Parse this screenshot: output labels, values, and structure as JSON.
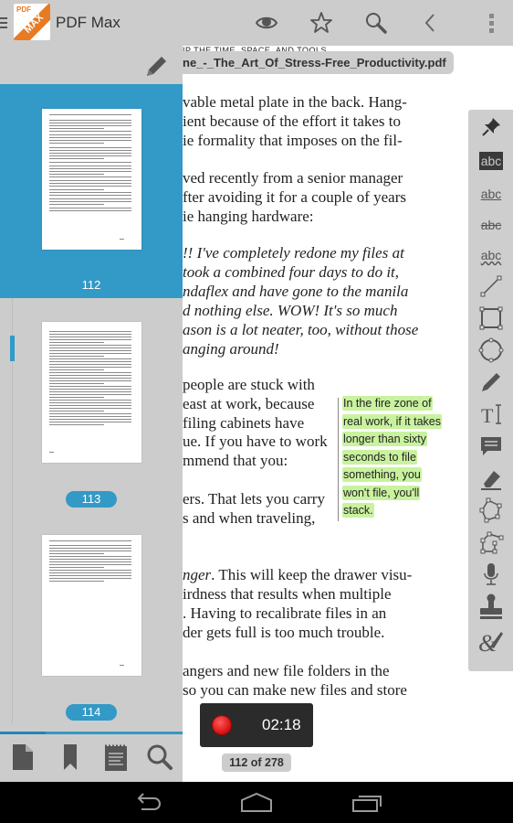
{
  "app": {
    "title": "PDF Max",
    "logo_top": "PDF",
    "logo_band": "MAX"
  },
  "actionbar": {
    "icons": [
      "menu-icon",
      "eye-icon",
      "star-icon",
      "search-icon",
      "chevron-left-icon",
      "overflow-menu-icon"
    ]
  },
  "document": {
    "running_head": "IP THE TIME, SPACE, AND TOOLS",
    "filename": "ne_-_The_Art_Of_Stress-Free_Productivity.pdf",
    "lines": [
      {
        "text": "vable metal plate in the back. Hang-",
        "style": "normal"
      },
      {
        "text": "ient because of the effort it takes to",
        "style": "normal"
      },
      {
        "text": "ie formality that imposes on the fil-",
        "style": "normal"
      },
      {
        "text": "",
        "style": "normal"
      },
      {
        "text": "ved recently from a senior manager",
        "style": "normal"
      },
      {
        "text": "fter avoiding it for a couple of years",
        "style": "normal"
      },
      {
        "text": "ie hanging hardware:",
        "style": "normal"
      },
      {
        "text": "",
        "style": "normal"
      },
      {
        "text": "!! I've completely redone my files at",
        "style": "italic"
      },
      {
        "text": "took a combined four days to do it,",
        "style": "italic"
      },
      {
        "text": "ndaflex and have gone to the manila",
        "style": "italic"
      },
      {
        "text": "d nothing else. WOW! It's so much",
        "style": "italic"
      },
      {
        "text": "ason is a lot neater, too, without those",
        "style": "italic"
      },
      {
        "text": "anging around!",
        "style": "italic"
      }
    ],
    "lines2": [
      "people are stuck with",
      "east at work, because",
      " filing cabinets have",
      "ue. If you have to work",
      "mmend that you:",
      "",
      "ers. That lets you carry",
      "s and when traveling,"
    ],
    "lines3": [
      {
        "text": "nger. This will keep the drawer visu-",
        "italic_prefix": "nger"
      },
      {
        "text": "irdness that results when multiple",
        "italic_prefix": ""
      },
      {
        "text": ". Having to recalibrate files in an",
        "italic_prefix": ""
      },
      {
        "text": "der gets full is too much trouble.",
        "italic_prefix": ""
      },
      {
        "text": "",
        "italic_prefix": ""
      },
      {
        "text": "angers and new file folders in the",
        "italic_prefix": ""
      },
      {
        "text": "so you can make new files and store",
        "italic_prefix": ""
      }
    ],
    "sidenote": [
      "In the fire zone of",
      "real work, if it takes",
      "longer than sixty",
      "seconds to file",
      "something, you",
      "won't file, you'll",
      "stack."
    ],
    "highlight_color": "#c9f29e"
  },
  "annotation_tools": [
    {
      "name": "pin-note-tool",
      "label": ""
    },
    {
      "name": "highlight-tool",
      "label": "abc"
    },
    {
      "name": "underline-tool",
      "label": "abc"
    },
    {
      "name": "strikeout-tool",
      "label": "abc"
    },
    {
      "name": "squiggly-tool",
      "label": "abc"
    },
    {
      "name": "line-tool",
      "label": ""
    },
    {
      "name": "rectangle-tool",
      "label": ""
    },
    {
      "name": "ellipse-tool",
      "label": ""
    },
    {
      "name": "pencil-tool",
      "label": ""
    },
    {
      "name": "text-box-tool",
      "label": "T"
    },
    {
      "name": "comment-tool",
      "label": ""
    },
    {
      "name": "eraser-tool",
      "label": ""
    },
    {
      "name": "polygon-tool",
      "label": ""
    },
    {
      "name": "polyline-tool",
      "label": ""
    },
    {
      "name": "audio-tool",
      "label": ""
    },
    {
      "name": "stamp-tool",
      "label": ""
    },
    {
      "name": "signature-tool",
      "label": ""
    }
  ],
  "recording": {
    "time": "02:18",
    "status": "recording"
  },
  "page_indicator": "112 of 278",
  "sidebar": {
    "thumbnails": [
      {
        "page": "112",
        "selected": true
      },
      {
        "page": "113",
        "selected": false
      },
      {
        "page": "114",
        "selected": false
      }
    ],
    "progress_fraction": 0.25,
    "tabs": [
      "pages-tab",
      "bookmarks-tab",
      "notes-tab",
      "search-tab"
    ]
  },
  "accent_color": "#3399c6",
  "navbar": {
    "buttons": [
      "back-button",
      "home-button",
      "recents-button"
    ]
  }
}
